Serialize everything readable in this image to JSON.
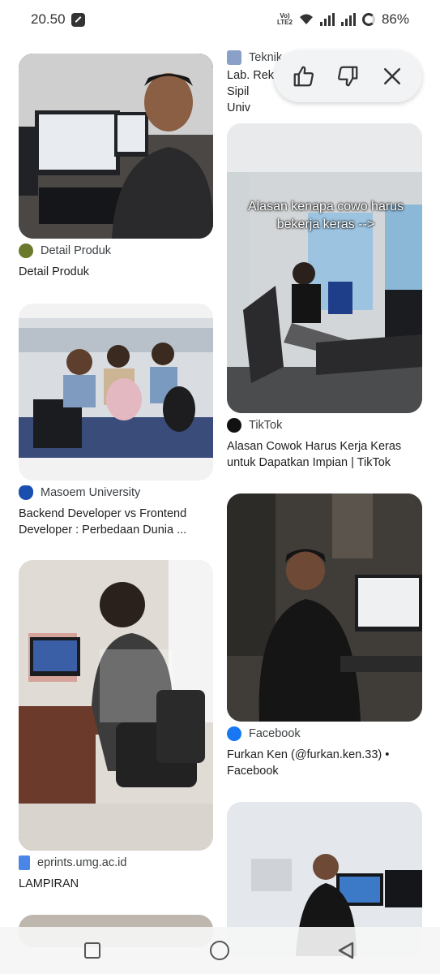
{
  "status_bar": {
    "time": "20.50",
    "network_label": "Vo)) LTE2",
    "battery": "86%"
  },
  "feedback_popup": {
    "thumbs_up_icon": "thumb-up-icon",
    "thumbs_down_icon": "thumb-down-icon",
    "close_icon": "close-icon"
  },
  "results": {
    "left": [
      {
        "source": "Detail Produk",
        "title": "Detail Produk",
        "icon_color": "#6a7a2a"
      },
      {
        "source": "Masoem University",
        "title": "Backend Developer vs Frontend Developer : Perbedaan Dunia ...",
        "icon_color": "#1a4fb0"
      },
      {
        "source": "eprints.umg.ac.id",
        "title": "LAMPIRAN",
        "icon_color": "#4a86e8"
      }
    ],
    "right": [
      {
        "source_partial": "Teknik",
        "title": "Lab. Rek Sipil Univ"
      },
      {
        "source": "TikTok",
        "title": "Alasan Cowok Harus Kerja Keras untuk Dapatkan Impian | TikTok",
        "overlay_text": "Alasan kenapa cowo harus bekerja keras -->",
        "icon_color": "#111111"
      },
      {
        "source": "Facebook",
        "title": "Furkan Ken (@furkan.ken.33) • Facebook",
        "icon_color": "#1877f2"
      }
    ]
  }
}
